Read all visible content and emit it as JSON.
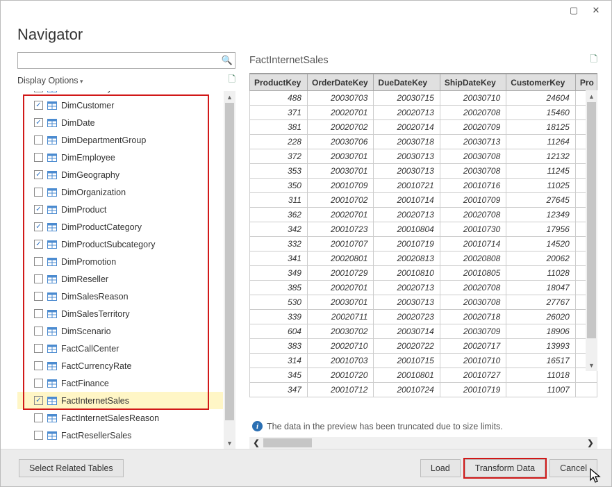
{
  "title": "Navigator",
  "search": {
    "placeholder": ""
  },
  "displayOptions": "Display Options",
  "tree": {
    "items": [
      {
        "label": "DimCurrency",
        "checked": false,
        "partial": true
      },
      {
        "label": "DimCustomer",
        "checked": true
      },
      {
        "label": "DimDate",
        "checked": true
      },
      {
        "label": "DimDepartmentGroup",
        "checked": false
      },
      {
        "label": "DimEmployee",
        "checked": false
      },
      {
        "label": "DimGeography",
        "checked": true
      },
      {
        "label": "DimOrganization",
        "checked": false
      },
      {
        "label": "DimProduct",
        "checked": true
      },
      {
        "label": "DimProductCategory",
        "checked": true
      },
      {
        "label": "DimProductSubcategory",
        "checked": true
      },
      {
        "label": "DimPromotion",
        "checked": false
      },
      {
        "label": "DimReseller",
        "checked": false
      },
      {
        "label": "DimSalesReason",
        "checked": false
      },
      {
        "label": "DimSalesTerritory",
        "checked": false
      },
      {
        "label": "DimScenario",
        "checked": false
      },
      {
        "label": "FactCallCenter",
        "checked": false
      },
      {
        "label": "FactCurrencyRate",
        "checked": false
      },
      {
        "label": "FactFinance",
        "checked": false
      },
      {
        "label": "FactInternetSales",
        "checked": true,
        "selected": true
      },
      {
        "label": "FactInternetSalesReason",
        "checked": false
      },
      {
        "label": "FactResellerSales",
        "checked": false
      }
    ]
  },
  "preview": {
    "title": "FactInternetSales",
    "columns": [
      "ProductKey",
      "OrderDateKey",
      "DueDateKey",
      "ShipDateKey",
      "CustomerKey",
      "Pro"
    ],
    "rows": [
      [
        488,
        20030703,
        20030715,
        20030710,
        24604
      ],
      [
        371,
        20020701,
        20020713,
        20020708,
        15460
      ],
      [
        381,
        20020702,
        20020714,
        20020709,
        18125
      ],
      [
        228,
        20030706,
        20030718,
        20030713,
        11264
      ],
      [
        372,
        20030701,
        20030713,
        20030708,
        12132
      ],
      [
        353,
        20030701,
        20030713,
        20030708,
        11245
      ],
      [
        350,
        20010709,
        20010721,
        20010716,
        11025
      ],
      [
        311,
        20010702,
        20010714,
        20010709,
        27645
      ],
      [
        362,
        20020701,
        20020713,
        20020708,
        12349
      ],
      [
        342,
        20010723,
        20010804,
        20010730,
        17956
      ],
      [
        332,
        20010707,
        20010719,
        20010714,
        14520
      ],
      [
        341,
        20020801,
        20020813,
        20020808,
        20062
      ],
      [
        349,
        20010729,
        20010810,
        20010805,
        11028
      ],
      [
        385,
        20020701,
        20020713,
        20020708,
        18047
      ],
      [
        530,
        20030701,
        20030713,
        20030708,
        27767
      ],
      [
        339,
        20020711,
        20020723,
        20020718,
        26020
      ],
      [
        604,
        20030702,
        20030714,
        20030709,
        18906
      ],
      [
        383,
        20020710,
        20020722,
        20020717,
        13993
      ],
      [
        314,
        20010703,
        20010715,
        20010710,
        16517
      ],
      [
        345,
        20010720,
        20010801,
        20010727,
        11018
      ],
      [
        347,
        20010712,
        20010724,
        20010719,
        11007
      ]
    ],
    "truncMsg": "The data in the preview has been truncated due to size limits."
  },
  "footer": {
    "selectRelated": "Select Related Tables",
    "load": "Load",
    "transform": "Transform Data",
    "cancel": "Cancel"
  }
}
